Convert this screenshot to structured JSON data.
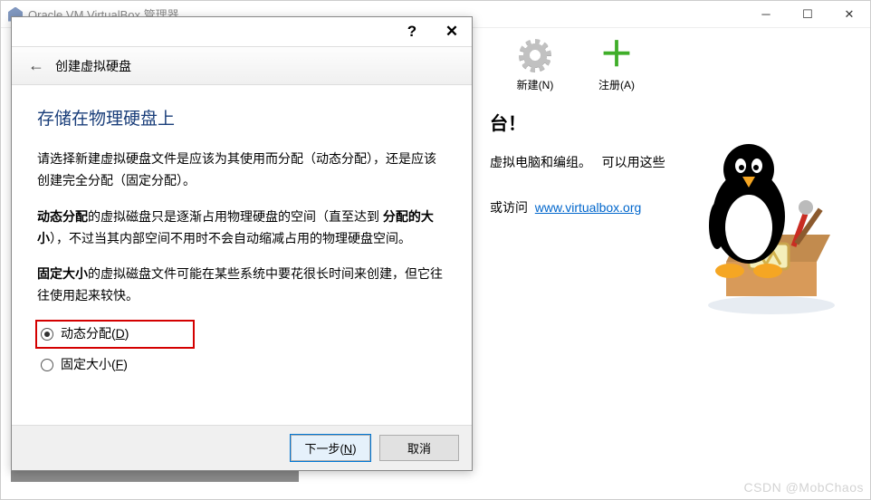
{
  "mainWindow": {
    "title": "Oracle VM VirtualBox 管理器",
    "toolbar": {
      "new": "新建(N)",
      "register": "注册(A)"
    },
    "welcome_tail": "台！",
    "para1_a": "虚拟电脑和编组。",
    "para1_b": "可以用这些",
    "para2_a": "或访问",
    "link": "www.virtualbox.org"
  },
  "dialog": {
    "headerTitle": "创建虚拟硬盘",
    "sectionTitle": "存储在物理硬盘上",
    "p1": "请选择新建虚拟硬盘文件是应该为其使用而分配（动态分配），还是应该创建完全分配（固定分配）。",
    "p2_a": "动态分配",
    "p2_b": "的虚拟磁盘只是逐渐占用物理硬盘的空间（直至达到 ",
    "p2_c": "分配的大小",
    "p2_d": "），不过当其内部空间不用时不会自动缩减占用的物理硬盘空间。",
    "p3_a": "固定大小",
    "p3_b": "的虚拟磁盘文件可能在某些系统中要花很长时间来创建，但它往往使用起来较快。",
    "radio1_a": "动态分配(",
    "radio1_b": ")",
    "radio2_a": "固定大小(",
    "radio2_b": ")",
    "buttons": {
      "next_a": "下一步(",
      "next_b": ")",
      "cancel": "取消"
    }
  },
  "watermark": "CSDN @MobChaos"
}
